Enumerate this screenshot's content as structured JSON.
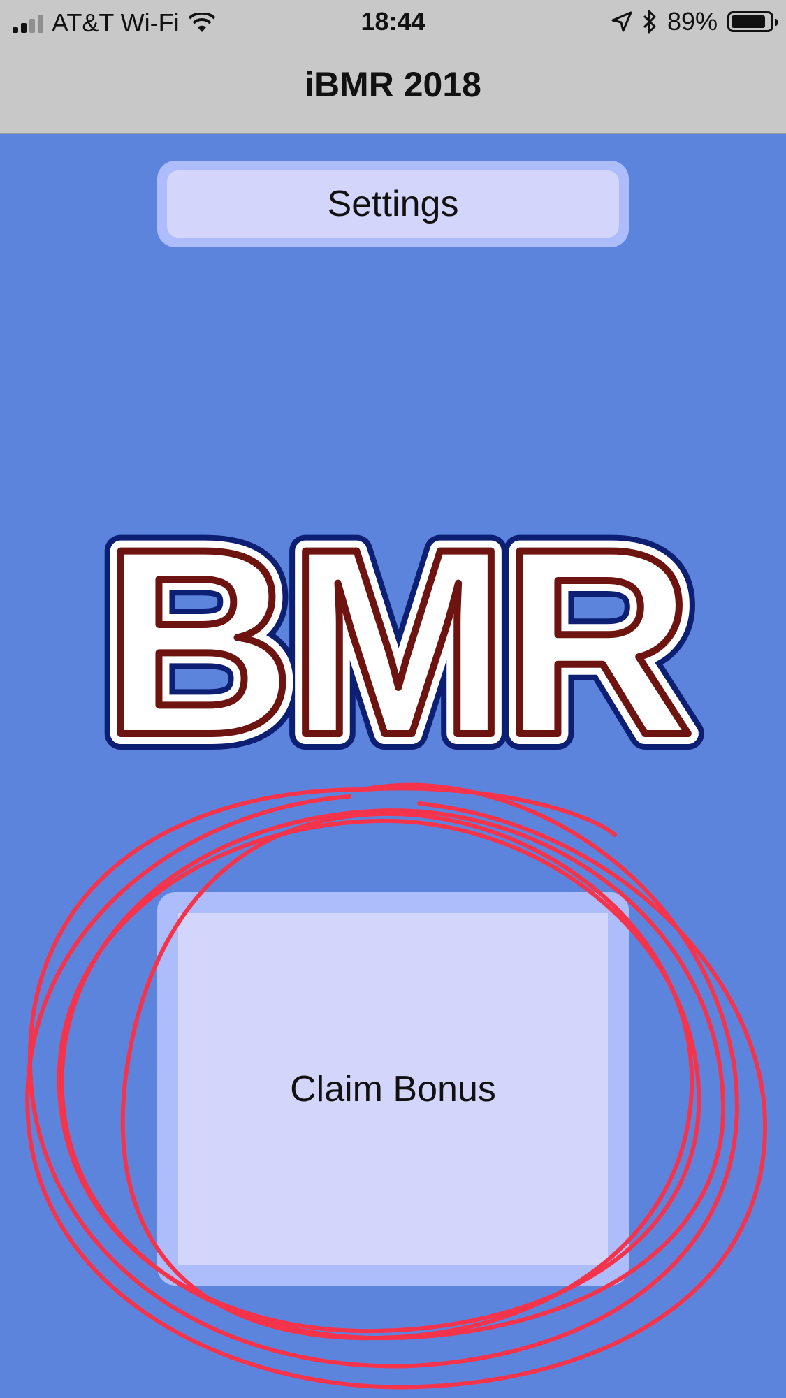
{
  "status_bar": {
    "carrier": "AT&T Wi-Fi",
    "time": "18:44",
    "battery_text": "89%",
    "battery_level": 0.89,
    "icons": [
      "signal-bars-icon",
      "wifi-icon",
      "location-arrow-icon",
      "bluetooth-icon",
      "battery-icon"
    ]
  },
  "nav": {
    "title": "iBMR 2018"
  },
  "main": {
    "settings_label": "Settings",
    "logo_text": "BMR",
    "claim_label": "Claim Bonus"
  },
  "colors": {
    "background": "#5d84dd",
    "bar": "#c8c8c8",
    "button_outer": "#adbdfb",
    "button_inner": "#d3d6fa",
    "logo_outline": "#0c1f73",
    "logo_inner_stroke": "#6e1410",
    "annotation": "#f5344c"
  }
}
